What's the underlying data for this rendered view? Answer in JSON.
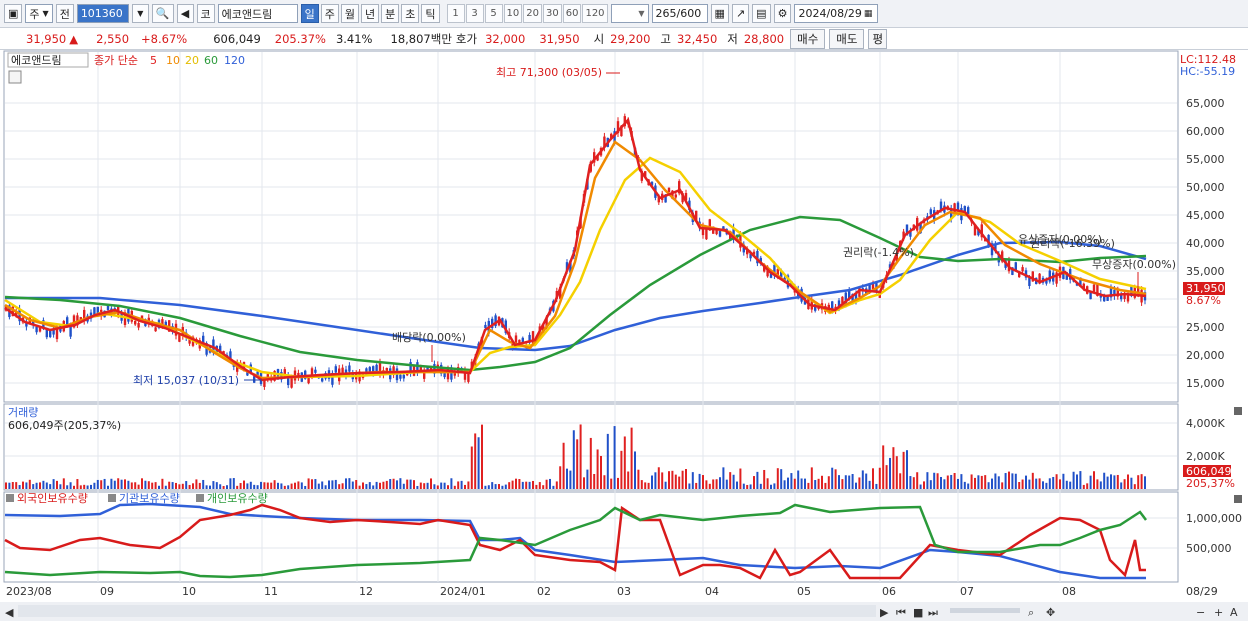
{
  "toolbar": {
    "market": "주",
    "prev": "전",
    "code": "101360",
    "stock_tag": "코",
    "stock_name": "에코앤드림",
    "periods": [
      "일",
      "주",
      "월",
      "년",
      "분",
      "초",
      "틱"
    ],
    "active_period": "일",
    "intervals": [
      "1",
      "3",
      "5",
      "10",
      "20",
      "30",
      "60",
      "120"
    ],
    "count": "265",
    "count_max": "/600",
    "date": "2024/08/29"
  },
  "quote": {
    "price": "31,950",
    "arrow": "▲",
    "change": "2,550",
    "change_pct": "+8.67%",
    "volume": "606,049",
    "volume_pct": "205.37%",
    "turnover_pct": "3.41%",
    "amount": "18,807백만",
    "ask_label": "호가",
    "ask": "32,000",
    "bid": "31,950",
    "open_label": "시",
    "open": "29,200",
    "high_label": "고",
    "high": "32,450",
    "low_label": "저",
    "low": "28,800",
    "buy_label": "매수",
    "sell_label": "매도",
    "eval_label": "평"
  },
  "price_pane": {
    "legend_name": "에코앤드림",
    "legend_ma": "종가 단순",
    "ma_periods": [
      "5",
      "10",
      "20",
      "60",
      "120"
    ],
    "ma_colors": [
      "#e02020",
      "#f08a00",
      "#f5d000",
      "#2a9a3a",
      "#3060d8"
    ],
    "lc": "LC:112.48",
    "hc": "HC:-55.19",
    "yticks": [
      "65,000",
      "60,000",
      "55,000",
      "50,000",
      "45,000",
      "40,000",
      "35,000",
      "30,000",
      "25,000",
      "20,000",
      "15,000"
    ],
    "last_price": "31,950",
    "last_pct": "8.67%",
    "ann_high": "최고 71,300 (03/05)",
    "ann_low": "최저 15,037 (10/31)",
    "ann_div": "배당락(0.00%)",
    "ann_rights": "권리락(-1.4%)",
    "ann_paid": "유상증자(0.00%)",
    "ann_rights2": "권리락(-16.39%)",
    "ann_free": "무상증자(0.00%)"
  },
  "volume_pane": {
    "title": "거래량",
    "value": "606,049주(205,37%)",
    "yticks": [
      "4,000K",
      "2,000K"
    ],
    "last": "606,049",
    "last_pct": "205,37%"
  },
  "holding_pane": {
    "legend": [
      "외국인보유수량",
      "기관보유수량",
      "개인보유수량"
    ],
    "legend_colors": [
      "#d81b1b",
      "#3060d8",
      "#2a9a3a"
    ],
    "yticks": [
      "1,000,000",
      "500,000"
    ]
  },
  "xaxis": {
    "labels": [
      "2023/08",
      "09",
      "10",
      "11",
      "12",
      "2024/01",
      "02",
      "03",
      "04",
      "05",
      "06",
      "07",
      "08",
      "08/29"
    ]
  }
}
